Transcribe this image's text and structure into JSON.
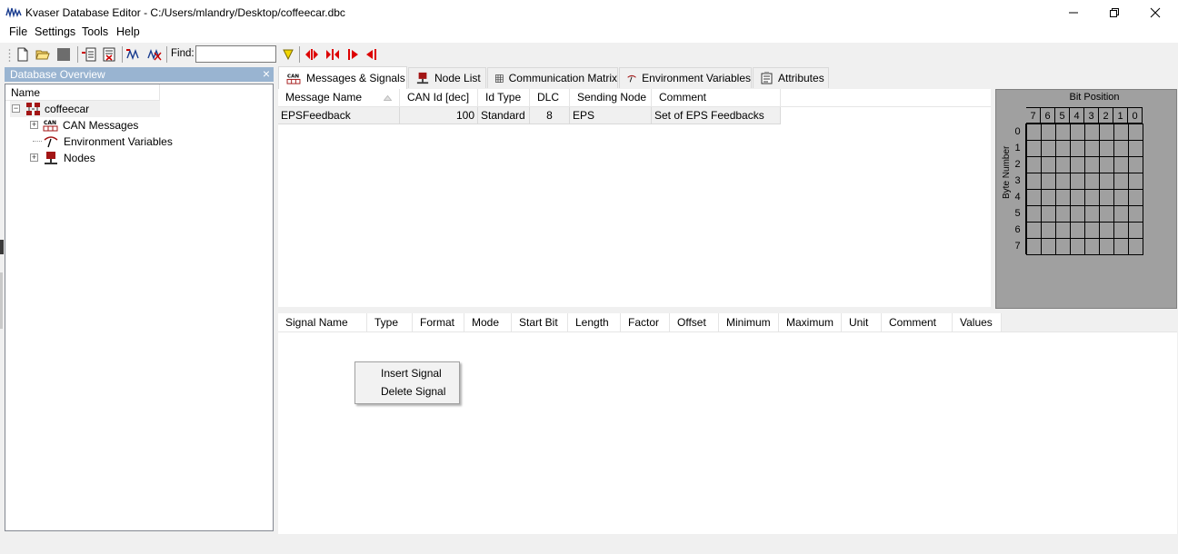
{
  "window": {
    "title": "Kvaser Database Editor - C:/Users/mlandry/Desktop/coffeecar.dbc"
  },
  "menu": [
    "File",
    "Settings",
    "Tools",
    "Help"
  ],
  "toolbar": {
    "find_label": "Find:",
    "find_value": "",
    "icons": [
      "new-file-icon",
      "open-folder-icon",
      "save-icon",
      "insert-message-icon",
      "delete-message-icon",
      "insert-signal-icon",
      "delete-signal-icon",
      "find-next-icon",
      "arrow-expand-icon",
      "arrow-collapse-icon",
      "arrow-right-icon",
      "arrow-left-icon"
    ]
  },
  "left_panel": {
    "header": "Database Overview",
    "close": "×",
    "column": "Name",
    "tree": [
      {
        "label": "coffeecar",
        "icon": "network-icon",
        "expander": "−"
      },
      {
        "label": "CAN Messages",
        "icon": "can-icon",
        "expander": "+"
      },
      {
        "label": "Environment Variables",
        "icon": "env-var-icon",
        "expander": ""
      },
      {
        "label": "Nodes",
        "icon": "node-icon",
        "expander": "+"
      }
    ]
  },
  "tabs": [
    {
      "label": "Messages & Signals",
      "icon": "can-icon",
      "active": true
    },
    {
      "label": "Node List",
      "icon": "node-icon",
      "active": false
    },
    {
      "label": "Communication Matrix",
      "icon": "grid-icon",
      "active": false
    },
    {
      "label": "Environment Variables",
      "icon": "env-var-icon",
      "active": false
    },
    {
      "label": "Attributes",
      "icon": "attributes-icon",
      "active": false
    }
  ],
  "messages": {
    "columns": [
      "Message Name",
      "CAN Id [dec]",
      "Id Type",
      "DLC",
      "Sending Node",
      "Comment"
    ],
    "rows": [
      {
        "name": "EPSFeedback",
        "can_id": "100",
        "id_type": "Standard",
        "dlc": "8",
        "sending_node": "EPS",
        "comment": "Set of EPS Feedbacks"
      }
    ]
  },
  "bit_panel": {
    "title": "Bit Position",
    "byte_label": "Byte Number",
    "bits": [
      "7",
      "6",
      "5",
      "4",
      "3",
      "2",
      "1",
      "0"
    ],
    "bytes": [
      "0",
      "1",
      "2",
      "3",
      "4",
      "5",
      "6",
      "7"
    ]
  },
  "signals": {
    "columns": [
      "Signal Name",
      "Type",
      "Format",
      "Mode",
      "Start Bit",
      "Length",
      "Factor",
      "Offset",
      "Minimum",
      "Maximum",
      "Unit",
      "Comment",
      "Values"
    ]
  },
  "context_menu": [
    "Insert Signal",
    "Delete Signal"
  ],
  "colors": {
    "panel_header": "#99b4d1",
    "bit_panel": "#a0a0a0",
    "selected_row": "#f0f0f0"
  }
}
